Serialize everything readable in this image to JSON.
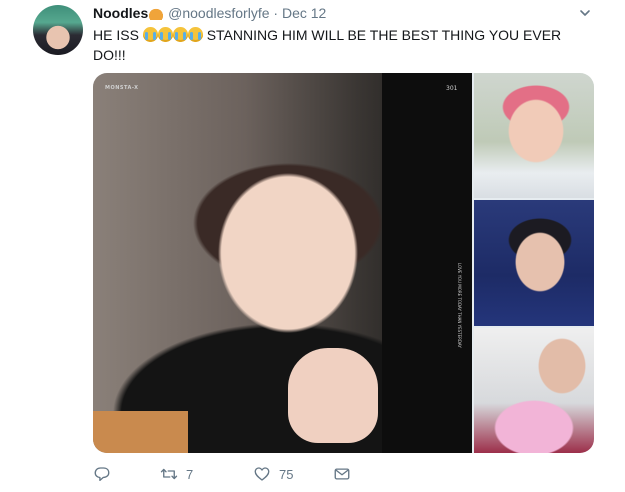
{
  "tweet": {
    "display_name": "Noodles",
    "handle": "@noodlesforlyfe",
    "separator": "·",
    "date": "Dec 12",
    "text": "HE ISS 😭😭😭😭 STANNING HIM WILL BE THE BEST THING YOU EVER DO!!!",
    "text_parts": {
      "prefix": "HE ISS",
      "suffix": "STANNING HIM WILL BE THE BEST THING YOU EVER DO!!!"
    }
  },
  "media": {
    "watermark_brand": "MONSTA-X",
    "watermark_number": "301",
    "watermark_side": "LOVE YOU MORE TODAY THAN YESTERDAY"
  },
  "actions": {
    "replies": "",
    "retweets": "7",
    "likes": "75"
  },
  "colors": {
    "text": "#14171a",
    "muted": "#657786"
  },
  "icons": {
    "reply": "reply-icon",
    "retweet": "retweet-icon",
    "like": "heart-icon",
    "dm": "envelope-icon",
    "menu": "chevron-down-icon"
  }
}
